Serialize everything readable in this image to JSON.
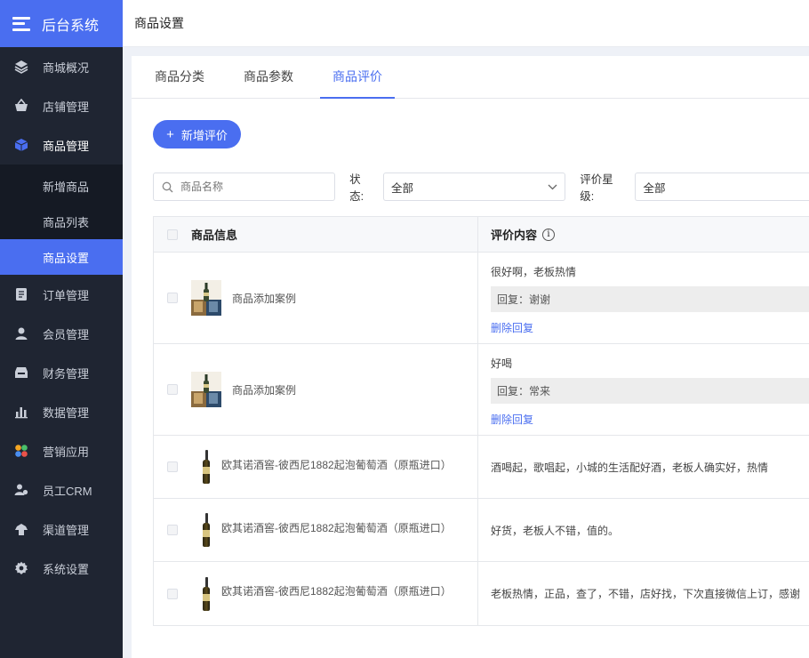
{
  "brand": {
    "title": "后台系统"
  },
  "sidebar": {
    "items": [
      {
        "label": "商城概况",
        "icon": "layers-icon"
      },
      {
        "label": "店铺管理",
        "icon": "basket-icon"
      },
      {
        "label": "商品管理",
        "icon": "cube-icon"
      },
      {
        "label": "订单管理",
        "icon": "document-icon"
      },
      {
        "label": "会员管理",
        "icon": "user-icon"
      },
      {
        "label": "财务管理",
        "icon": "wallet-icon"
      },
      {
        "label": "数据管理",
        "icon": "bar-chart-icon"
      },
      {
        "label": "营销应用",
        "icon": "apps-icon"
      },
      {
        "label": "员工CRM",
        "icon": "team-icon"
      },
      {
        "label": "渠道管理",
        "icon": "channel-icon"
      },
      {
        "label": "系统设置",
        "icon": "gear-icon"
      }
    ],
    "sub_items": [
      {
        "label": "新增商品"
      },
      {
        "label": "商品列表"
      },
      {
        "label": "商品设置"
      }
    ]
  },
  "header": {
    "title": "商品设置"
  },
  "tabs": [
    {
      "label": "商品分类"
    },
    {
      "label": "商品参数"
    },
    {
      "label": "商品评价"
    }
  ],
  "toolbar": {
    "add_label": "新增评价"
  },
  "filters": {
    "search_placeholder": "商品名称",
    "status_label": "状态:",
    "status_value": "全部",
    "rating_label": "评价星级:",
    "rating_value": "全部"
  },
  "table": {
    "col_product": "商品信息",
    "col_review": "评价内容",
    "rows": [
      {
        "product": "商品添加案例",
        "review": "很好啊，老板热情",
        "reply": "回复：谢谢",
        "action": "删除回复"
      },
      {
        "product": "商品添加案例",
        "review": "好喝",
        "reply": "回复：常来",
        "action": "删除回复"
      },
      {
        "product": "欧其诺酒窖-彼西尼1882起泡葡萄酒（原瓶进口）",
        "review": "酒喝起，歌唱起，小城的生活配好酒，老板人确实好，热情"
      },
      {
        "product": "欧其诺酒窖-彼西尼1882起泡葡萄酒（原瓶进口）",
        "review": "好货，老板人不错，值的。"
      },
      {
        "product": "欧其诺酒窖-彼西尼1882起泡葡萄酒（原瓶进口）",
        "review": "老板热情，正品，查了，不错，店好找，下次直接微信上订，感谢"
      }
    ]
  },
  "colors": {
    "primary": "#4a6ef0",
    "sidebar_bg": "#1f2532",
    "submenu_bg": "#151a24"
  }
}
